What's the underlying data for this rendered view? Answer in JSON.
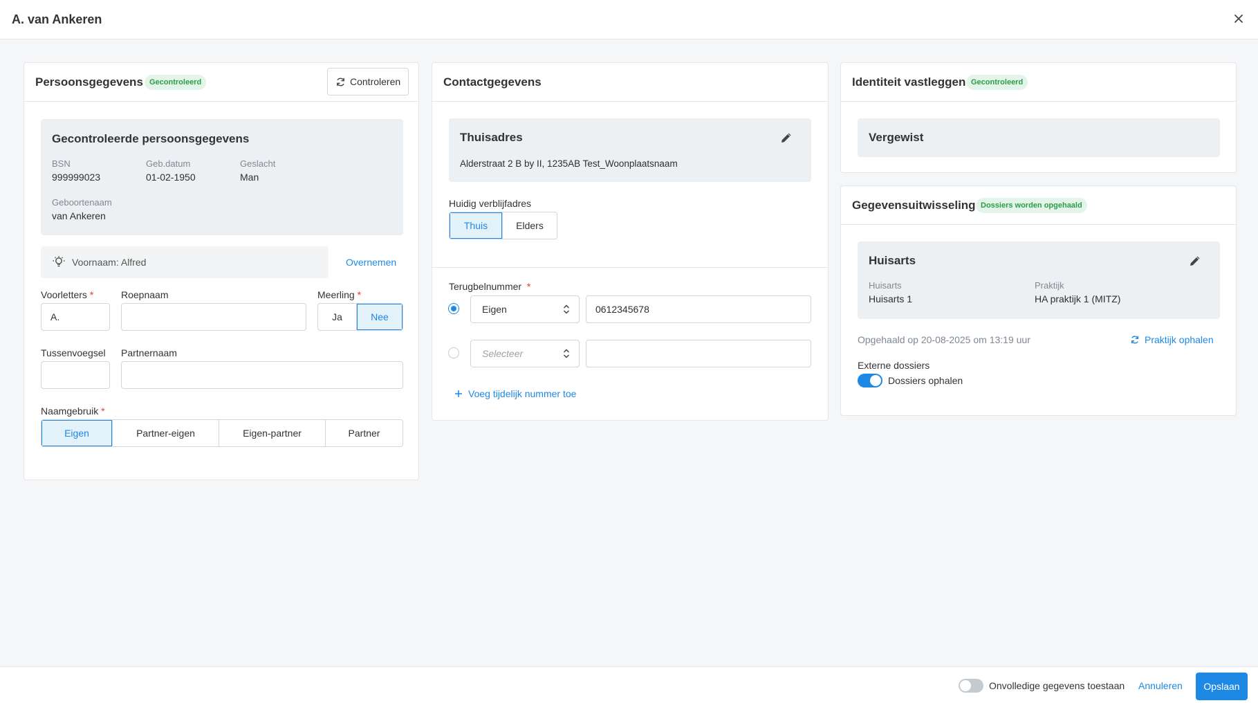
{
  "window": {
    "title": "A. van Ankeren"
  },
  "persoonsgegevens": {
    "title": "Persoonsgegevens",
    "badge": "Gecontroleerd",
    "check_button": "Controleren",
    "panel": {
      "title": "Gecontroleerde persoonsgegevens",
      "bsn_label": "BSN",
      "bsn": "999999023",
      "gebdatum_label": "Geb.datum",
      "gebdatum": "01-02-1950",
      "geslacht_label": "Geslacht",
      "geslacht": "Man",
      "geboortenaam_label": "Geboortenaam",
      "geboortenaam": "van Ankeren"
    },
    "suggestion": {
      "text": "Voornaam: Alfred",
      "action": "Overnemen"
    },
    "voorletters": {
      "label": "Voorletters",
      "value": "A."
    },
    "roepnaam": {
      "label": "Roepnaam",
      "value": ""
    },
    "meerling": {
      "label": "Meerling",
      "options": [
        "Ja",
        "Nee"
      ],
      "selected": "Nee"
    },
    "tussenvoegsel": {
      "label": "Tussenvoegsel",
      "value": ""
    },
    "partnernaam": {
      "label": "Partnernaam",
      "value": ""
    },
    "naamgebruik": {
      "label": "Naamgebruik",
      "options": [
        "Eigen",
        "Partner-eigen",
        "Eigen-partner",
        "Partner"
      ],
      "selected": "Eigen"
    }
  },
  "contactgegevens": {
    "title": "Contactgegevens",
    "address": {
      "title": "Thuisadres",
      "line": "Alderstraat 2 B by II, 1235AB Test_Woonplaatsnaam"
    },
    "verblijf": {
      "label": "Huidig verblijfadres",
      "options": [
        "Thuis",
        "Elders"
      ],
      "selected": "Thuis"
    },
    "terugbel": {
      "label": "Terugbelnummer",
      "row1": {
        "type": "Eigen",
        "number": "0612345678",
        "selected": true
      },
      "row2": {
        "type_placeholder": "Selecteer",
        "number": "",
        "selected": false
      },
      "add_link": "Voeg tijdelijk nummer toe"
    }
  },
  "identiteit": {
    "title": "Identiteit vastleggen",
    "badge": "Gecontroleerd",
    "status": "Vergewist"
  },
  "gegevensuitwisseling": {
    "title": "Gegevensuitwisseling",
    "badge": "Dossiers worden opgehaald",
    "panel": {
      "title": "Huisarts",
      "huisarts_label": "Huisarts",
      "huisarts": "Huisarts 1",
      "praktijk_label": "Praktijk",
      "praktijk": "HA praktijk 1 (MITZ)"
    },
    "fetched": "Opgehaald op 20-08-2025 om 13:19 uur",
    "fetch_link": "Praktijk ophalen",
    "external_label": "Externe dossiers",
    "external_toggle": "Dossiers ophalen",
    "external_enabled": true
  },
  "footer": {
    "incomplete_toggle": "Onvolledige gegevens toestaan",
    "incomplete_enabled": false,
    "cancel": "Annuleren",
    "save": "Opslaan"
  },
  "colors": {
    "accent": "#1e88e5",
    "success": "#2e9a4a",
    "success_bg": "#e3f5e8",
    "panel_bg": "#edf0f3"
  }
}
